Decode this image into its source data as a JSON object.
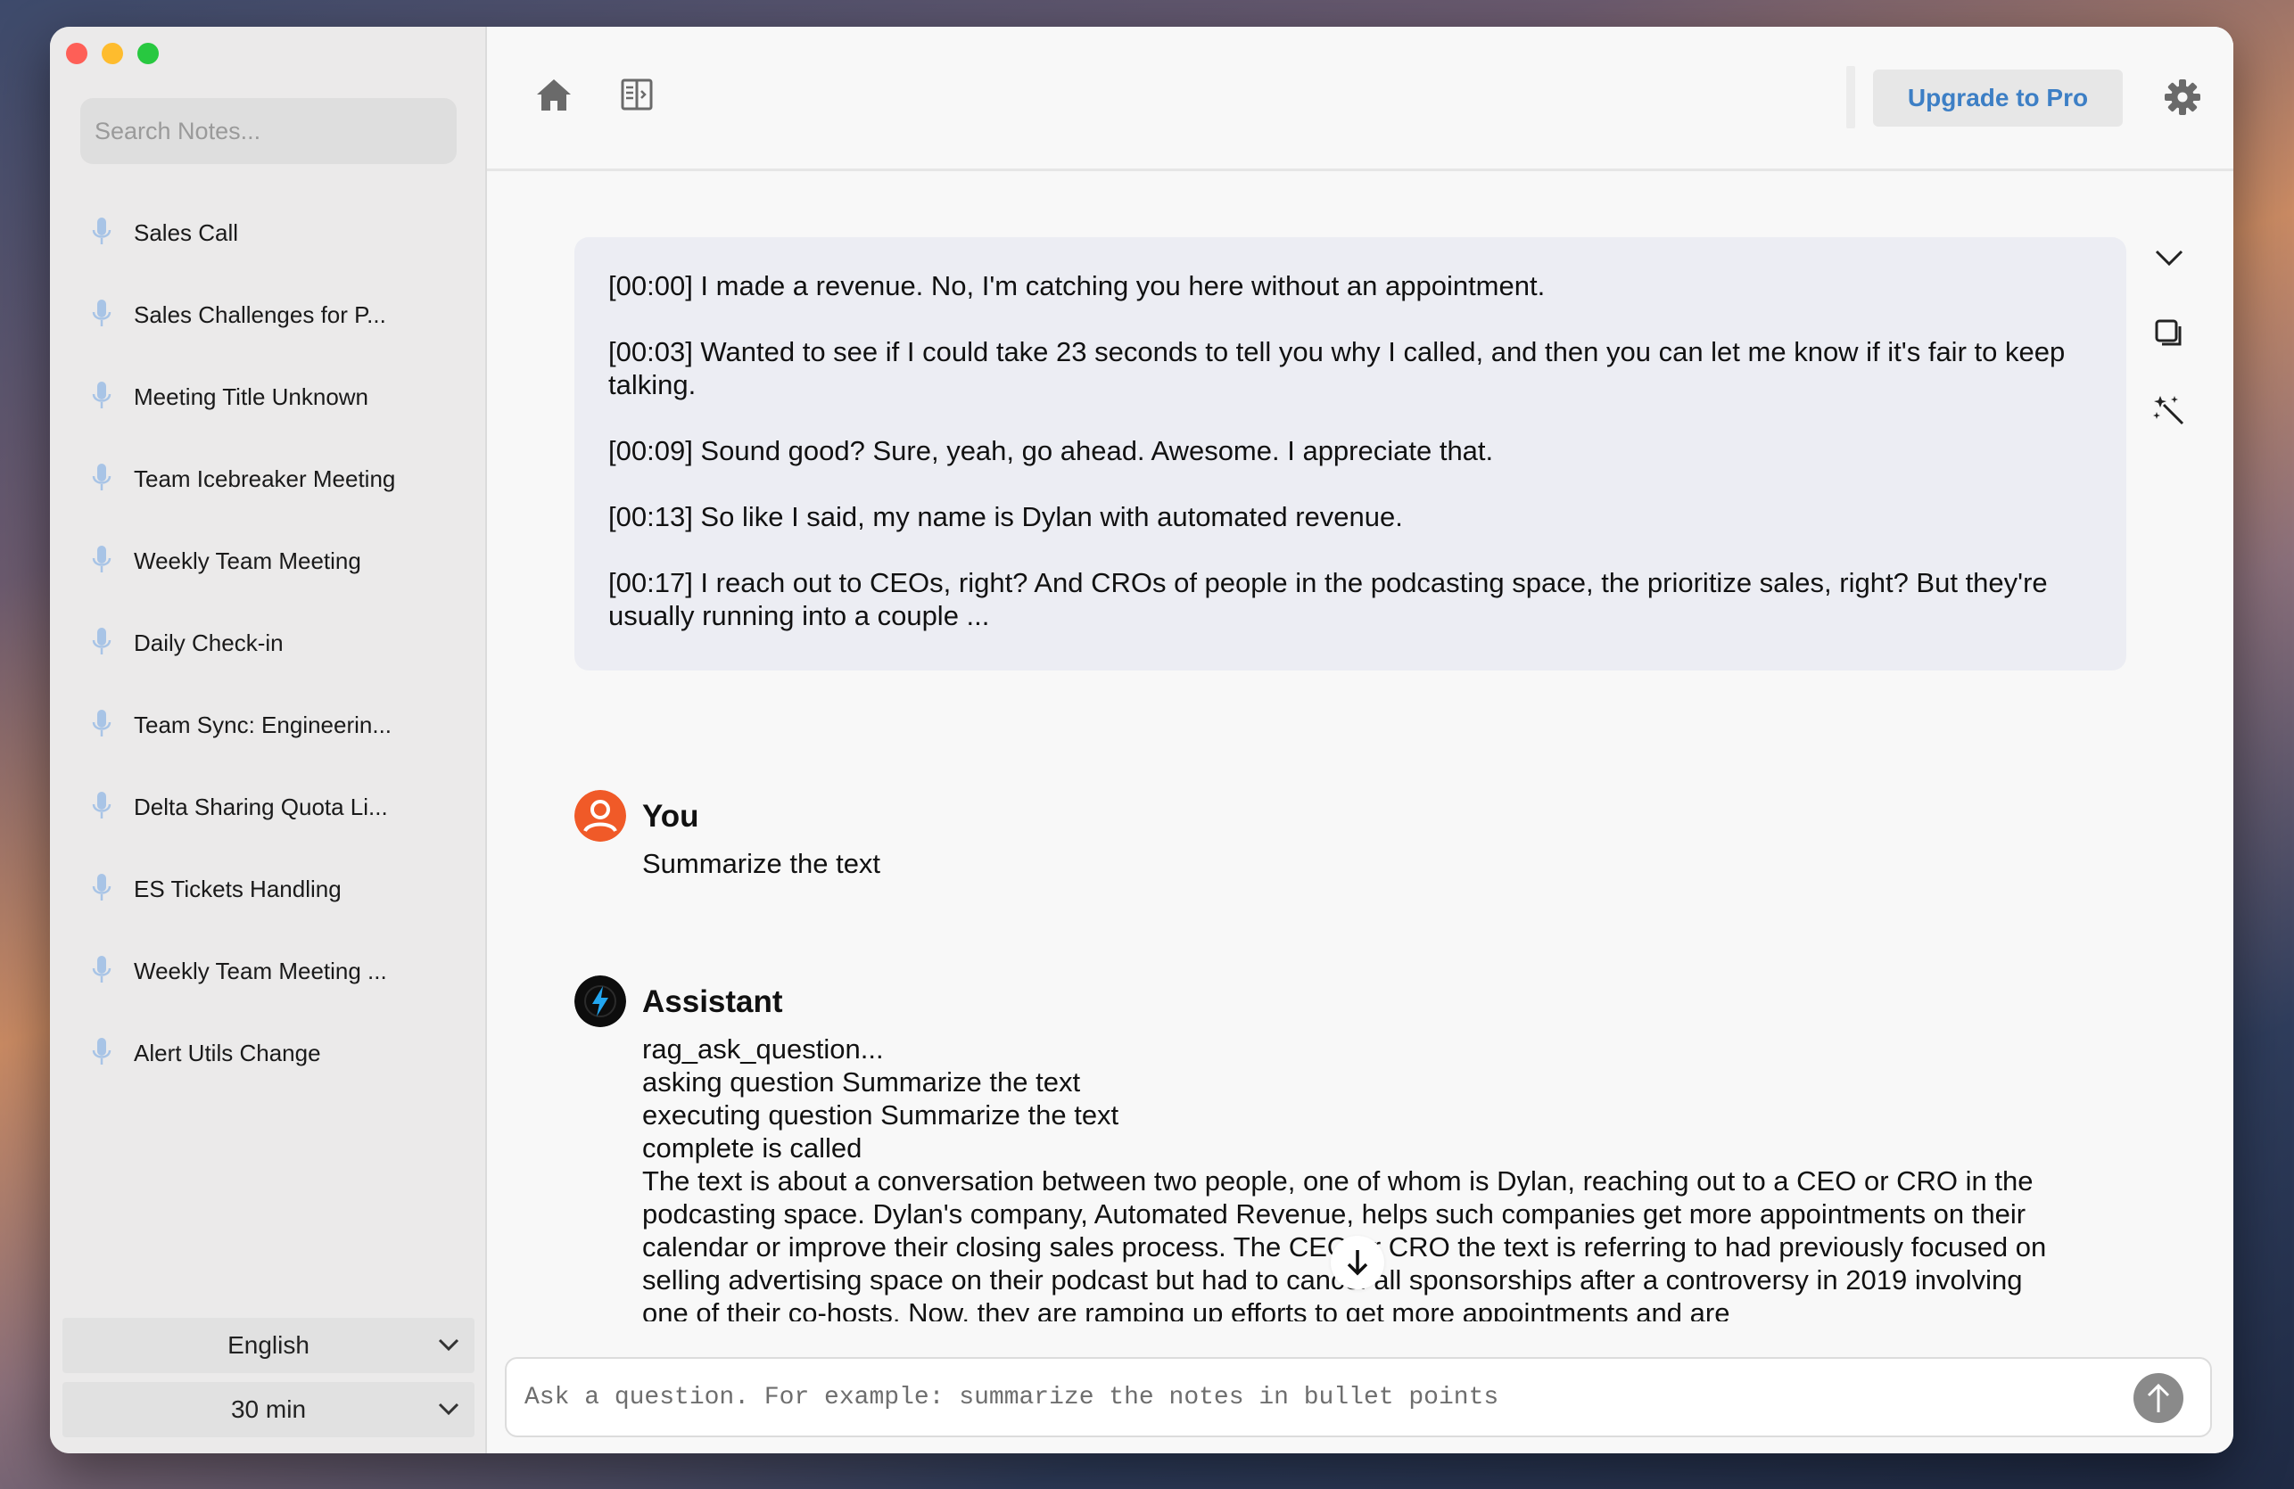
{
  "sidebar": {
    "search_placeholder": "Search Notes...",
    "notes": [
      {
        "label": "Sales Call",
        "icon": "mic-icon"
      },
      {
        "label": "Sales Challenges for P...",
        "icon": "mic-icon"
      },
      {
        "label": "Meeting Title Unknown",
        "icon": "mic-icon"
      },
      {
        "label": "Team Icebreaker Meeting",
        "icon": "mic-icon"
      },
      {
        "label": "Weekly Team Meeting",
        "icon": "mic-icon"
      },
      {
        "label": "Daily Check-in",
        "icon": "mic-icon"
      },
      {
        "label": "Team Sync: Engineerin...",
        "icon": "mic-icon"
      },
      {
        "label": "Delta Sharing Quota Li...",
        "icon": "mic-icon"
      },
      {
        "label": "ES Tickets Handling",
        "icon": "mic-icon"
      },
      {
        "label": "Weekly Team Meeting ...",
        "icon": "mic-icon"
      },
      {
        "label": "Alert Utils Change",
        "icon": "mic-icon"
      }
    ],
    "language_select": {
      "value": "English",
      "icon": "chevron-down-icon"
    },
    "duration_select": {
      "value": "30 min",
      "icon": "chevron-down-icon"
    }
  },
  "topbar": {
    "home_icon": "home-icon",
    "panel_icon": "panel-toggle-icon",
    "upgrade_label": "Upgrade to Pro",
    "settings_icon": "gear-icon"
  },
  "transcript": {
    "lines": [
      "[00:00] I made a revenue. No, I'm catching you here without an appointment.",
      "[00:03] Wanted to see if I could take 23 seconds to tell you why I called, and then you can let me know if it's fair to keep talking.",
      "[00:09] Sound good? Sure, yeah, go ahead. Awesome. I appreciate that.",
      "[00:13] So like I said, my name is Dylan with automated revenue.",
      "[00:17] I reach out to CEOs, right? And CROs of people in the podcasting space, the prioritize sales, right? But they're usually running into a couple ..."
    ],
    "tools": [
      "chevron-down-icon",
      "copy-icon",
      "magic-wand-icon"
    ]
  },
  "chat": {
    "you": {
      "name": "You",
      "text": "Summarize the text",
      "color": "#f05a28"
    },
    "assistant": {
      "name": "Assistant",
      "lines": [
        "rag_ask_question...",
        "asking question Summarize the text",
        "executing question Summarize the text",
        "complete is called",
        "The text is about a conversation between two people, one of whom is Dylan, reaching out to a CEO or CRO in the podcasting space. Dylan's company, Automated Revenue, helps such companies get more appointments on their calendar or improve their closing sales process. The CEO or CRO the text is referring to had previously focused on selling advertising space on their podcast but had to cancel all sponsorships after a controversy in 2019 involving one of their co-hosts. Now, they are ramping up efforts to get more appointments and are"
      ]
    }
  },
  "composer": {
    "placeholder": "Ask a question. For example: summarize the notes in bullet points",
    "send_icon": "send-arrow-icon",
    "scroll_down_icon": "arrow-down-icon"
  }
}
